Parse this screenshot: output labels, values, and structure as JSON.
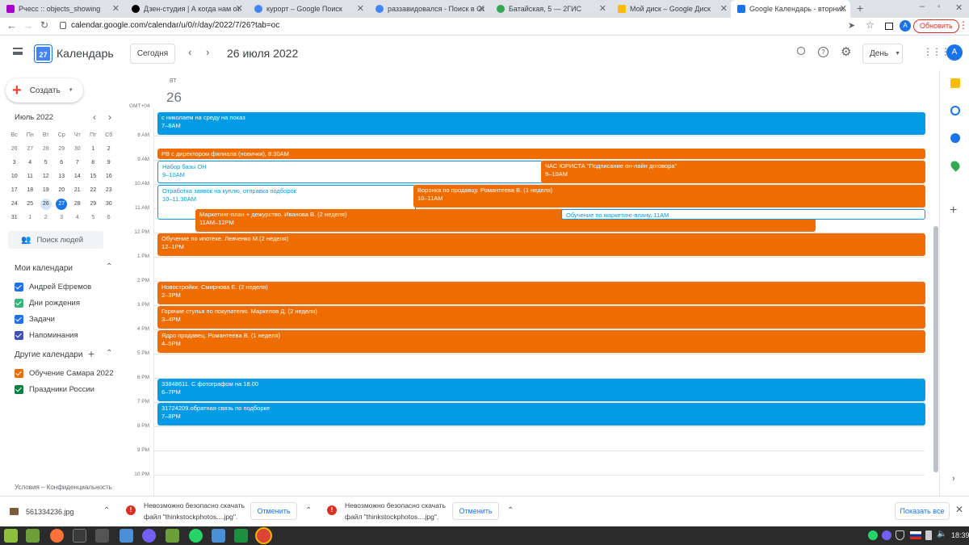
{
  "browser": {
    "tabs": [
      {
        "title": "Рчесс :: objects_showing",
        "fav": "#a0c"
      },
      {
        "title": "Дзен-студия | А когда нам от...",
        "fav": "#000"
      },
      {
        "title": "курорт – Google Поиск",
        "fav": "#4285f4"
      },
      {
        "title": "раззавидовался - Поиск в Go...",
        "fav": "#4285f4"
      },
      {
        "title": "Батайская, 5 — 2ГИС",
        "fav": "#34a853"
      },
      {
        "title": "Мой диск – Google Диск",
        "fav": "#fbbc04"
      },
      {
        "title": "Google Календарь - вторник...",
        "fav": "#1a73e8"
      }
    ],
    "url": "calendar.google.com/calendar/u/0/r/day/2022/7/26?tab=oc",
    "avatar": "A",
    "update_label": "Обновить"
  },
  "header": {
    "app_name": "Календарь",
    "today_label": "Сегодня",
    "date_title": "26 июля 2022",
    "view_label": "День",
    "icon_day": "27",
    "avatar": "A"
  },
  "sidebar": {
    "create_label": "Создать",
    "month_title": "Июль 2022",
    "weekdays": [
      "Вс",
      "Пн",
      "Вт",
      "Ср",
      "Чт",
      "Пт",
      "Сб"
    ],
    "weeks": [
      [
        "26",
        "27",
        "28",
        "29",
        "30",
        "1",
        "2"
      ],
      [
        "3",
        "4",
        "5",
        "6",
        "7",
        "8",
        "9"
      ],
      [
        "10",
        "11",
        "12",
        "13",
        "14",
        "15",
        "16"
      ],
      [
        "17",
        "18",
        "19",
        "20",
        "21",
        "22",
        "23"
      ],
      [
        "24",
        "25",
        "26",
        "27",
        "28",
        "29",
        "30"
      ],
      [
        "31",
        "1",
        "2",
        "3",
        "4",
        "5",
        "6"
      ]
    ],
    "search_people": "Поиск людей",
    "my_calendars_title": "Мои календари",
    "my_calendars": [
      {
        "name": "Андрей Ефремов",
        "color": "#1a73e8"
      },
      {
        "name": "Дни рождения",
        "color": "#33b679"
      },
      {
        "name": "Задачи",
        "color": "#1a73e8"
      },
      {
        "name": "Напоминания",
        "color": "#3f51b5"
      }
    ],
    "other_calendars_title": "Другие календари",
    "other_calendars": [
      {
        "name": "Обучение Самара 2022",
        "color": "#ef6c00"
      },
      {
        "name": "Праздники России",
        "color": "#0b8043"
      }
    ],
    "footer": "Условия – Конфиденциальность"
  },
  "day": {
    "weekday": "ВТ",
    "date": "26",
    "tz": "GMT+04",
    "hours": [
      "8 AM",
      "9 AM",
      "10 AM",
      "11 AM",
      "12 PM",
      "1 PM",
      "2 PM",
      "3 PM",
      "4 PM",
      "5 PM",
      "6 PM",
      "7 PM",
      "8 PM",
      "9 PM",
      "10 PM"
    ]
  },
  "events": [
    {
      "title": "с николаем на среду на показ",
      "time": "7–8AM",
      "color": "blue"
    },
    {
      "title": "РВ с директором филиала (новички), 8:30AM",
      "time": "",
      "color": "orange"
    },
    {
      "title": "Набор базы ОН",
      "time": "9–10AM",
      "color": "ow"
    },
    {
      "title": "ЧАС ЮРИСТА \"Подписание он-лайн договора\"",
      "time": "9–10AM",
      "color": "orange"
    },
    {
      "title": "Отработка заявок на куплю, отправка подборок",
      "time": "10–11:30AM",
      "color": "ow"
    },
    {
      "title": "Воронка по продавцу. Романтеева В. (1 неделя)",
      "time": "10–11AM",
      "color": "orange"
    },
    {
      "title": "Маркетинг-план + дежурство. Иванова В. (2 неделя)",
      "time": "11AM–12PM",
      "color": "orange"
    },
    {
      "title": "Обучение по маркетинг-плану, 11AM",
      "time": "",
      "color": "ow"
    },
    {
      "title": "Обучение по ипотеке. Левченко М.(2 неделя)",
      "time": "12–1PM",
      "color": "orange"
    },
    {
      "title": "Новостройки. Смирнова Е. (2 неделя)",
      "time": "2–3PM",
      "color": "orange"
    },
    {
      "title": "Горячие стулья по покупателю. Маркелов Д. (2 неделя)",
      "time": "3–4PM",
      "color": "orange"
    },
    {
      "title": "Ядро продавец. Романтеева В. (1 неделя)",
      "time": "4–5PM",
      "color": "orange"
    },
    {
      "title": "33848611. С фотографом на 18.00",
      "time": "6–7PM",
      "color": "blue"
    },
    {
      "title": "31724209.обратная связь по подборке",
      "time": "7–8PM",
      "color": "blue"
    }
  ],
  "downloads": {
    "file": "561334236.jpg",
    "warn_line1": "Невозможно безопасно скачать",
    "warn_line2": "файл \"thinkstockphotos....jpg\".",
    "cancel": "Отменить",
    "show_all": "Показать все"
  },
  "taskbar": {
    "clock": "18:39"
  }
}
